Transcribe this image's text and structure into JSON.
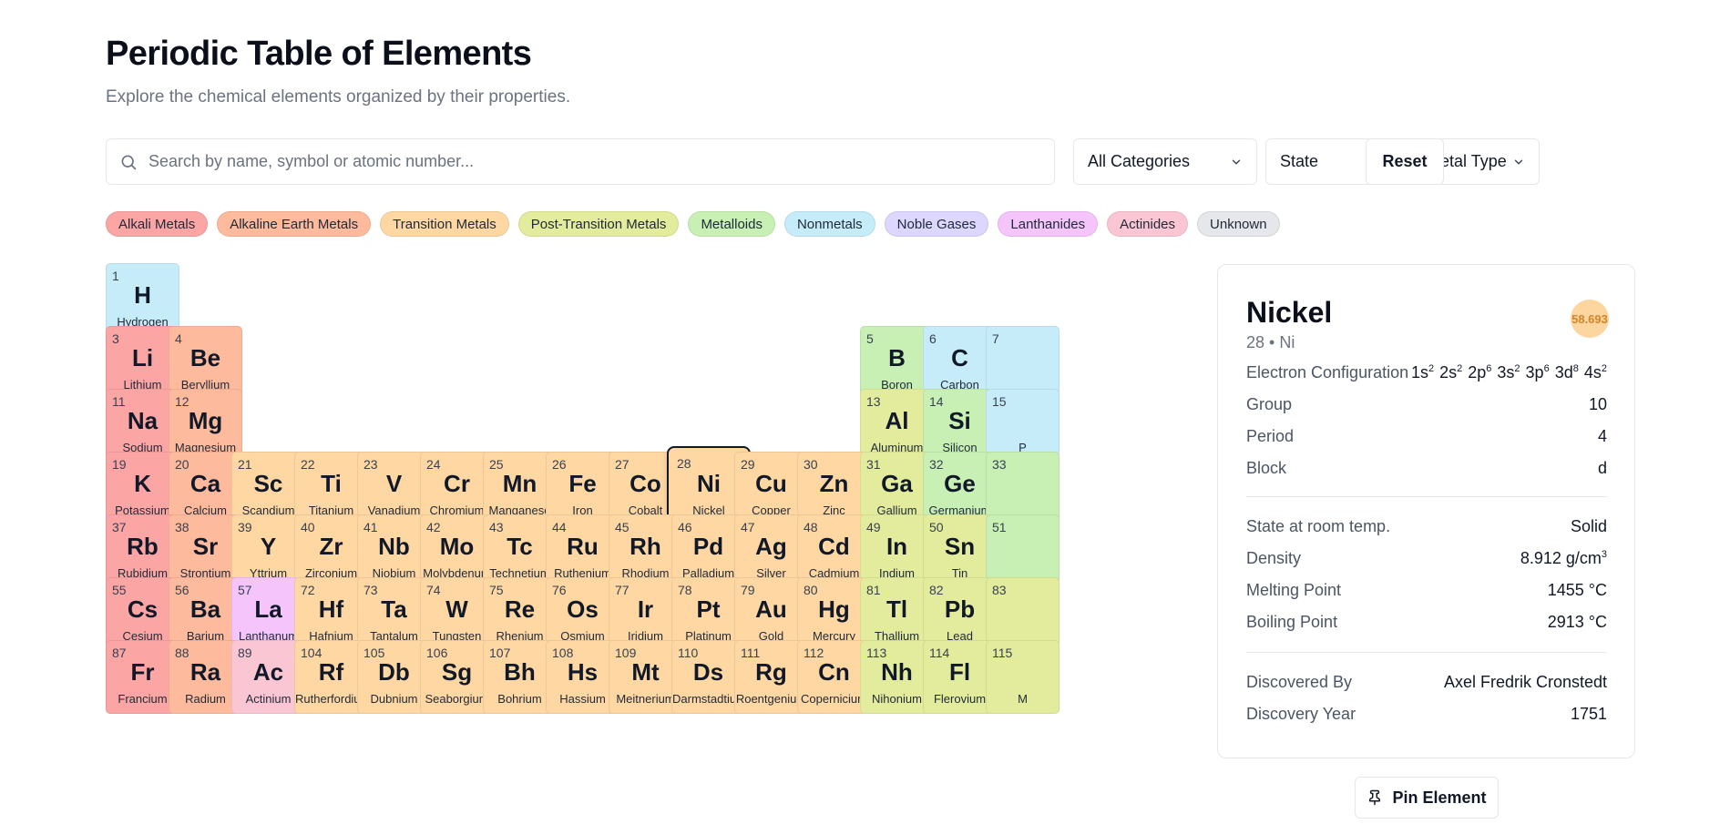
{
  "header": {
    "title": "Periodic Table of Elements",
    "subtitle": "Explore the chemical elements organized by their properties."
  },
  "search": {
    "placeholder": "Search by name, symbol or atomic number...",
    "value": ""
  },
  "filters": {
    "category": "All Categories",
    "state": "State",
    "metal_type": "Metal Type",
    "reset_label": "Reset"
  },
  "categories": [
    {
      "key": "alkali",
      "label": "Alkali Metals",
      "color": "#fca5a5"
    },
    {
      "key": "alkaline",
      "label": "Alkaline Earth Metals",
      "color": "#fdba9c"
    },
    {
      "key": "transition",
      "label": "Transition Metals",
      "color": "#fed7a3"
    },
    {
      "key": "post",
      "label": "Post-Transition Metals",
      "color": "#e3ec9c"
    },
    {
      "key": "metalloid",
      "label": "Metalloids",
      "color": "#c8f0b4"
    },
    {
      "key": "nonmetal",
      "label": "Nonmetals",
      "color": "#c6ecf9"
    },
    {
      "key": "noble",
      "label": "Noble Gases",
      "color": "#ddd6fe"
    },
    {
      "key": "lanthanide",
      "label": "Lanthanides",
      "color": "#f5c4fb"
    },
    {
      "key": "actinide",
      "label": "Actinides",
      "color": "#fbc6d4"
    },
    {
      "key": "unknown",
      "label": "Unknown",
      "color": "#e5e7eb"
    }
  ],
  "elements": [
    {
      "n": 1,
      "s": "H",
      "name": "Hydrogen",
      "cat": "nonmetal",
      "col": 1,
      "row": 1
    },
    {
      "n": 3,
      "s": "Li",
      "name": "Lithium",
      "cat": "alkali",
      "col": 1,
      "row": 2
    },
    {
      "n": 4,
      "s": "Be",
      "name": "Beryllium",
      "cat": "alkaline",
      "col": 2,
      "row": 2
    },
    {
      "n": 5,
      "s": "B",
      "name": "Boron",
      "cat": "metalloid",
      "col": 13,
      "row": 2
    },
    {
      "n": 6,
      "s": "C",
      "name": "Carbon",
      "cat": "nonmetal",
      "col": 14,
      "row": 2
    },
    {
      "n": 7,
      "s": "",
      "name": "",
      "cat": "nonmetal",
      "col": 15,
      "row": 2
    },
    {
      "n": 11,
      "s": "Na",
      "name": "Sodium",
      "cat": "alkali",
      "col": 1,
      "row": 3
    },
    {
      "n": 12,
      "s": "Mg",
      "name": "Magnesium",
      "cat": "alkaline",
      "col": 2,
      "row": 3
    },
    {
      "n": 13,
      "s": "Al",
      "name": "Aluminum",
      "cat": "post",
      "col": 13,
      "row": 3
    },
    {
      "n": 14,
      "s": "Si",
      "name": "Silicon",
      "cat": "metalloid",
      "col": 14,
      "row": 3
    },
    {
      "n": 15,
      "s": "",
      "name": "P",
      "cat": "nonmetal",
      "col": 15,
      "row": 3
    },
    {
      "n": 19,
      "s": "K",
      "name": "Potassium",
      "cat": "alkali",
      "col": 1,
      "row": 4
    },
    {
      "n": 20,
      "s": "Ca",
      "name": "Calcium",
      "cat": "alkaline",
      "col": 2,
      "row": 4
    },
    {
      "n": 21,
      "s": "Sc",
      "name": "Scandium",
      "cat": "transition",
      "col": 3,
      "row": 4
    },
    {
      "n": 22,
      "s": "Ti",
      "name": "Titanium",
      "cat": "transition",
      "col": 4,
      "row": 4
    },
    {
      "n": 23,
      "s": "V",
      "name": "Vanadium",
      "cat": "transition",
      "col": 5,
      "row": 4
    },
    {
      "n": 24,
      "s": "Cr",
      "name": "Chromium",
      "cat": "transition",
      "col": 6,
      "row": 4
    },
    {
      "n": 25,
      "s": "Mn",
      "name": "Manganese",
      "cat": "transition",
      "col": 7,
      "row": 4
    },
    {
      "n": 26,
      "s": "Fe",
      "name": "Iron",
      "cat": "transition",
      "col": 8,
      "row": 4
    },
    {
      "n": 27,
      "s": "Co",
      "name": "Cobalt",
      "cat": "transition",
      "col": 9,
      "row": 4
    },
    {
      "n": 28,
      "s": "Ni",
      "name": "Nickel",
      "cat": "transition",
      "col": 10,
      "row": 4,
      "selected": true
    },
    {
      "n": 29,
      "s": "Cu",
      "name": "Copper",
      "cat": "transition",
      "col": 11,
      "row": 4
    },
    {
      "n": 30,
      "s": "Zn",
      "name": "Zinc",
      "cat": "transition",
      "col": 12,
      "row": 4
    },
    {
      "n": 31,
      "s": "Ga",
      "name": "Gallium",
      "cat": "post",
      "col": 13,
      "row": 4
    },
    {
      "n": 32,
      "s": "Ge",
      "name": "Germanium",
      "cat": "metalloid",
      "col": 14,
      "row": 4
    },
    {
      "n": 33,
      "s": "",
      "name": "",
      "cat": "metalloid",
      "col": 15,
      "row": 4
    },
    {
      "n": 37,
      "s": "Rb",
      "name": "Rubidium",
      "cat": "alkali",
      "col": 1,
      "row": 5
    },
    {
      "n": 38,
      "s": "Sr",
      "name": "Strontium",
      "cat": "alkaline",
      "col": 2,
      "row": 5
    },
    {
      "n": 39,
      "s": "Y",
      "name": "Yttrium",
      "cat": "transition",
      "col": 3,
      "row": 5
    },
    {
      "n": 40,
      "s": "Zr",
      "name": "Zirconium",
      "cat": "transition",
      "col": 4,
      "row": 5
    },
    {
      "n": 41,
      "s": "Nb",
      "name": "Niobium",
      "cat": "transition",
      "col": 5,
      "row": 5
    },
    {
      "n": 42,
      "s": "Mo",
      "name": "Molybdenum",
      "cat": "transition",
      "col": 6,
      "row": 5
    },
    {
      "n": 43,
      "s": "Tc",
      "name": "Technetium",
      "cat": "transition",
      "col": 7,
      "row": 5
    },
    {
      "n": 44,
      "s": "Ru",
      "name": "Ruthenium",
      "cat": "transition",
      "col": 8,
      "row": 5
    },
    {
      "n": 45,
      "s": "Rh",
      "name": "Rhodium",
      "cat": "transition",
      "col": 9,
      "row": 5
    },
    {
      "n": 46,
      "s": "Pd",
      "name": "Palladium",
      "cat": "transition",
      "col": 10,
      "row": 5
    },
    {
      "n": 47,
      "s": "Ag",
      "name": "Silver",
      "cat": "transition",
      "col": 11,
      "row": 5
    },
    {
      "n": 48,
      "s": "Cd",
      "name": "Cadmium",
      "cat": "transition",
      "col": 12,
      "row": 5
    },
    {
      "n": 49,
      "s": "In",
      "name": "Indium",
      "cat": "post",
      "col": 13,
      "row": 5
    },
    {
      "n": 50,
      "s": "Sn",
      "name": "Tin",
      "cat": "post",
      "col": 14,
      "row": 5
    },
    {
      "n": 51,
      "s": "",
      "name": "",
      "cat": "metalloid",
      "col": 15,
      "row": 5
    },
    {
      "n": 55,
      "s": "Cs",
      "name": "Cesium",
      "cat": "alkali",
      "col": 1,
      "row": 6
    },
    {
      "n": 56,
      "s": "Ba",
      "name": "Barium",
      "cat": "alkaline",
      "col": 2,
      "row": 6
    },
    {
      "n": 57,
      "s": "La",
      "name": "Lanthanum",
      "cat": "lanthanide",
      "col": 3,
      "row": 6
    },
    {
      "n": 72,
      "s": "Hf",
      "name": "Hafnium",
      "cat": "transition",
      "col": 4,
      "row": 6
    },
    {
      "n": 73,
      "s": "Ta",
      "name": "Tantalum",
      "cat": "transition",
      "col": 5,
      "row": 6
    },
    {
      "n": 74,
      "s": "W",
      "name": "Tungsten",
      "cat": "transition",
      "col": 6,
      "row": 6
    },
    {
      "n": 75,
      "s": "Re",
      "name": "Rhenium",
      "cat": "transition",
      "col": 7,
      "row": 6
    },
    {
      "n": 76,
      "s": "Os",
      "name": "Osmium",
      "cat": "transition",
      "col": 8,
      "row": 6
    },
    {
      "n": 77,
      "s": "Ir",
      "name": "Iridium",
      "cat": "transition",
      "col": 9,
      "row": 6
    },
    {
      "n": 78,
      "s": "Pt",
      "name": "Platinum",
      "cat": "transition",
      "col": 10,
      "row": 6
    },
    {
      "n": 79,
      "s": "Au",
      "name": "Gold",
      "cat": "transition",
      "col": 11,
      "row": 6
    },
    {
      "n": 80,
      "s": "Hg",
      "name": "Mercury",
      "cat": "transition",
      "col": 12,
      "row": 6
    },
    {
      "n": 81,
      "s": "Tl",
      "name": "Thallium",
      "cat": "post",
      "col": 13,
      "row": 6
    },
    {
      "n": 82,
      "s": "Pb",
      "name": "Lead",
      "cat": "post",
      "col": 14,
      "row": 6
    },
    {
      "n": 83,
      "s": "",
      "name": "",
      "cat": "post",
      "col": 15,
      "row": 6
    },
    {
      "n": 87,
      "s": "Fr",
      "name": "Francium",
      "cat": "alkali",
      "col": 1,
      "row": 7
    },
    {
      "n": 88,
      "s": "Ra",
      "name": "Radium",
      "cat": "alkaline",
      "col": 2,
      "row": 7
    },
    {
      "n": 89,
      "s": "Ac",
      "name": "Actinium",
      "cat": "actinide",
      "col": 3,
      "row": 7
    },
    {
      "n": 104,
      "s": "Rf",
      "name": "Rutherfordium",
      "cat": "transition",
      "col": 4,
      "row": 7
    },
    {
      "n": 105,
      "s": "Db",
      "name": "Dubnium",
      "cat": "transition",
      "col": 5,
      "row": 7
    },
    {
      "n": 106,
      "s": "Sg",
      "name": "Seaborgium",
      "cat": "transition",
      "col": 6,
      "row": 7
    },
    {
      "n": 107,
      "s": "Bh",
      "name": "Bohrium",
      "cat": "transition",
      "col": 7,
      "row": 7
    },
    {
      "n": 108,
      "s": "Hs",
      "name": "Hassium",
      "cat": "transition",
      "col": 8,
      "row": 7
    },
    {
      "n": 109,
      "s": "Mt",
      "name": "Meitnerium",
      "cat": "transition",
      "col": 9,
      "row": 7
    },
    {
      "n": 110,
      "s": "Ds",
      "name": "Darmstadtium",
      "cat": "transition",
      "col": 10,
      "row": 7
    },
    {
      "n": 111,
      "s": "Rg",
      "name": "Roentgenium",
      "cat": "transition",
      "col": 11,
      "row": 7
    },
    {
      "n": 112,
      "s": "Cn",
      "name": "Copernicium",
      "cat": "transition",
      "col": 12,
      "row": 7
    },
    {
      "n": 113,
      "s": "Nh",
      "name": "Nihonium",
      "cat": "post",
      "col": 13,
      "row": 7
    },
    {
      "n": 114,
      "s": "Fl",
      "name": "Flerovium",
      "cat": "post",
      "col": 14,
      "row": 7
    },
    {
      "n": 115,
      "s": "",
      "name": "M",
      "cat": "post",
      "col": 15,
      "row": 7
    }
  ],
  "detail": {
    "name": "Nickel",
    "subtitle": "28 • Ni",
    "atomic_mass": "58.693",
    "electron_config_label": "Electron Configuration",
    "electron_config": [
      {
        "base": "1s",
        "exp": "2"
      },
      {
        "base": "2s",
        "exp": "2"
      },
      {
        "base": "2p",
        "exp": "6"
      },
      {
        "base": "3s",
        "exp": "2"
      },
      {
        "base": "3p",
        "exp": "6"
      },
      {
        "base": "3d",
        "exp": "8"
      },
      {
        "base": "4s",
        "exp": "2"
      }
    ],
    "group_label": "Group",
    "group": "10",
    "period_label": "Period",
    "period": "4",
    "block_label": "Block",
    "block": "d",
    "state_label": "State at room temp.",
    "state": "Solid",
    "density_label": "Density",
    "density": "8.912 g/cm",
    "density_exp": "3",
    "melting_label": "Melting Point",
    "melting": "1455 °C",
    "boiling_label": "Boiling Point",
    "boiling": "2913 °C",
    "discovered_by_label": "Discovered By",
    "discovered_by": "Axel Fredrik Cronstedt",
    "discovery_year_label": "Discovery Year",
    "discovery_year": "1751",
    "pin_label": "Pin Element"
  }
}
